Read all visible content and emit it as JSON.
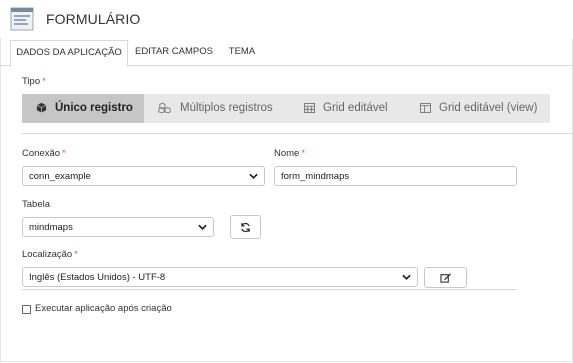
{
  "header": {
    "title": "FORMULÁRIO",
    "icon": "form-icon"
  },
  "tabs": [
    {
      "label": "DADOS DA APLICAÇÃO",
      "active": true
    },
    {
      "label": "EDITAR CAMPOS",
      "active": false
    },
    {
      "label": "TEMA",
      "active": false
    }
  ],
  "tipo": {
    "label": "Tipo",
    "options": [
      {
        "label": "Único registro",
        "icon": "cube-icon",
        "active": true
      },
      {
        "label": "Múltiplos registros",
        "icon": "cubes-icon",
        "active": false
      },
      {
        "label": "Grid editável",
        "icon": "table-icon",
        "active": false
      },
      {
        "label": "Grid editável (view)",
        "icon": "columns-icon",
        "active": false
      }
    ]
  },
  "conexao": {
    "label": "Conexão",
    "value": "conn_example"
  },
  "nome": {
    "label": "Nome",
    "value": "form_mindmaps"
  },
  "tabela": {
    "label": "Tabela",
    "value": "mindmaps",
    "refresh_icon": "refresh-icon"
  },
  "localizacao": {
    "label": "Localização",
    "value": "Inglês (Estados Unidos) - UTF-8",
    "edit_icon": "edit-icon"
  },
  "executar": {
    "label": "Executar aplicação após criação",
    "checked": false
  },
  "colors": {
    "required": "#d9534f",
    "segment_bg": "#e8e8e8",
    "segment_active": "#c6c6c6"
  }
}
